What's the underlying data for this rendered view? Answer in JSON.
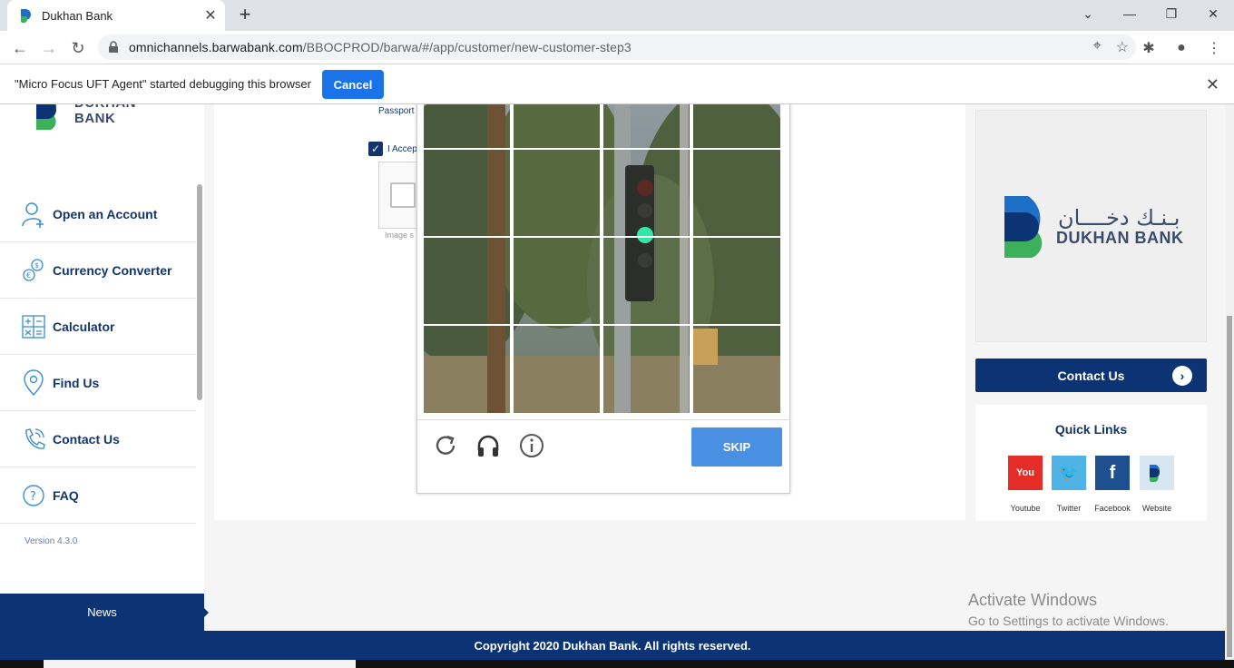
{
  "browser": {
    "tab_title": "Dukhan Bank",
    "new_tab": "+",
    "tab_close": "✕",
    "url_host": "omnichannels.barwabank.com",
    "url_path": "/BBOCPROD/barwa/#/app/customer/new-customer-step3"
  },
  "debugbar": {
    "message": "\"Micro Focus UFT Agent\" started debugging this browser",
    "cancel_label": "Cancel",
    "close": "✕"
  },
  "sidebar": {
    "logo_text": "DUKHAN BANK",
    "items": [
      {
        "label": "Open an Account",
        "icon": "add-user-icon"
      },
      {
        "label": "Currency Converter",
        "icon": "currency-exchange-icon"
      },
      {
        "label": "Calculator",
        "icon": "calculator-icon"
      },
      {
        "label": "Find Us",
        "icon": "location-pin-icon"
      },
      {
        "label": "Contact Us",
        "icon": "phone-icon"
      },
      {
        "label": "FAQ",
        "icon": "question-icon"
      }
    ],
    "version": "Version 4.3.0",
    "news_label": "News"
  },
  "form": {
    "passport_label": "Passport",
    "accept_label": "I Accep",
    "image_source": "Image s"
  },
  "captcha": {
    "skip_label": "SKIP",
    "icons": [
      "reload-icon",
      "audio-icon",
      "info-icon"
    ]
  },
  "right": {
    "logo_arabic": "بـنـك دخــــان",
    "logo_text": "DUKHAN BANK",
    "contact_label": "Contact Us",
    "quick_title": "Quick Links",
    "links": [
      {
        "label": "Youtube",
        "color": "#e52d27"
      },
      {
        "label": "Twitter",
        "color": "#4fb3e6"
      },
      {
        "label": "Facebook",
        "color": "#1e4f8f"
      },
      {
        "label": "Website",
        "color": "#d8e6f2"
      }
    ]
  },
  "watermark": {
    "title": "Activate Windows",
    "subtitle": "Go to Settings to activate Windows."
  },
  "footer": {
    "copyright": "Copyright 2020 Dukhan Bank. All rights reserved."
  },
  "colors": {
    "brand_navy": "#0c3474",
    "brand_blue": "#1e6fc7",
    "brand_green": "#3cb05a",
    "skip_blue": "#4a90e2"
  }
}
